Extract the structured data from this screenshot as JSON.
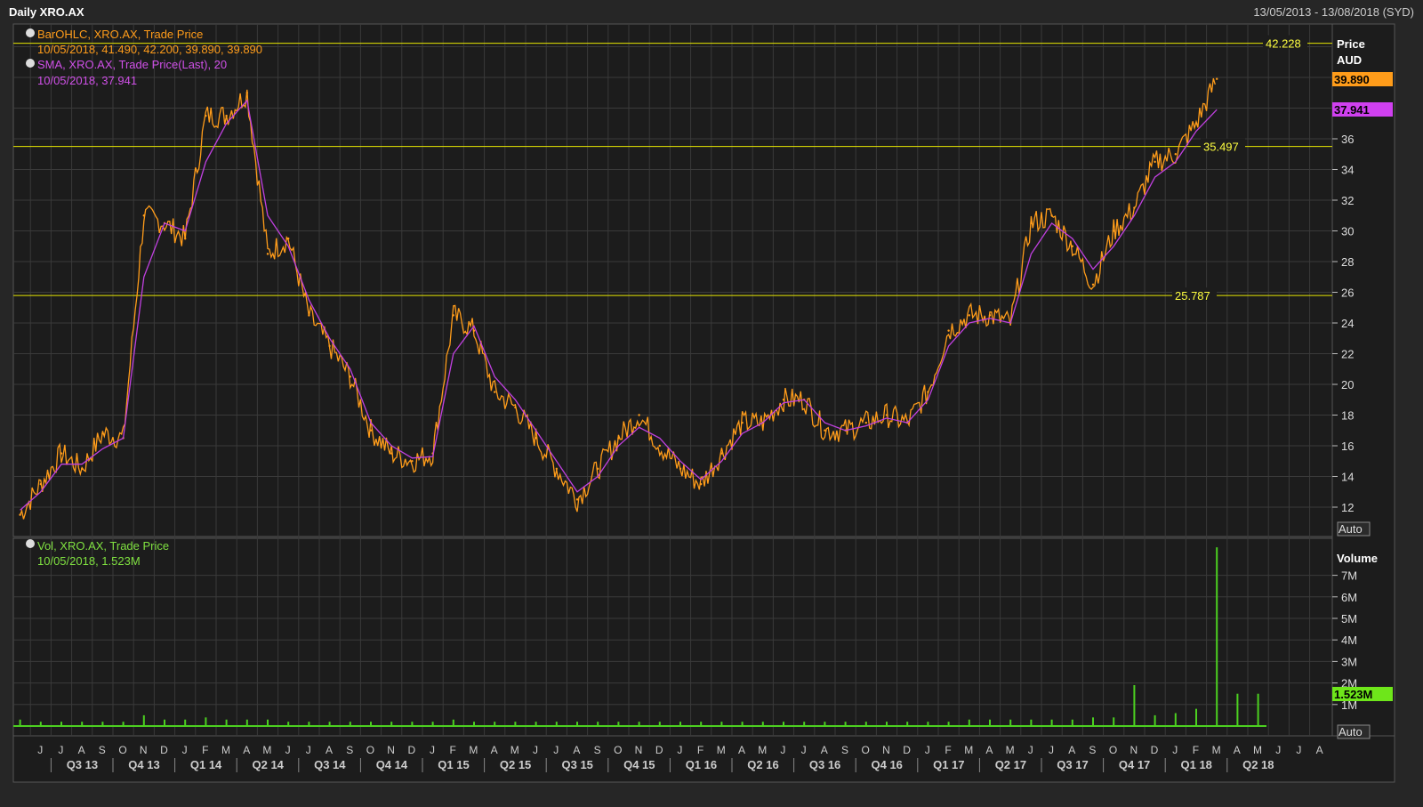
{
  "header": {
    "title": "Daily XRO.AX",
    "range": "13/05/2013 - 13/08/2018 (SYD)"
  },
  "legend": {
    "ohlc_title": "BarOHLC, XRO.AX, Trade Price",
    "ohlc_values": "10/05/2018, 41.490, 42.200, 39.890, 39.890",
    "sma_title": "SMA, XRO.AX, Trade Price(Last),  20",
    "sma_values": "10/05/2018, 37.941",
    "vol_title": "Vol, XRO.AX, Trade Price",
    "vol_values": "10/05/2018, 1.523M"
  },
  "price_axis": {
    "title": "Price",
    "unit": "AUD",
    "ticks": [
      "12",
      "14",
      "16",
      "18",
      "20",
      "22",
      "24",
      "26",
      "28",
      "30",
      "32",
      "34",
      "36"
    ],
    "current_price": "39.890",
    "current_sma": "37.941",
    "auto_label": "Auto"
  },
  "volume_axis": {
    "title": "Volume",
    "ticks": [
      "1M",
      "2M",
      "3M",
      "4M",
      "5M",
      "6M",
      "7M"
    ],
    "current_volume": "1.523M",
    "auto_label": "Auto"
  },
  "hlines": [
    {
      "label": "42.228",
      "value": 42.228
    },
    {
      "label": "35.497",
      "value": 35.497
    },
    {
      "label": "25.787",
      "value": 25.787
    }
  ],
  "x_axis": {
    "months": [
      "J",
      "J",
      "A",
      "S",
      "O",
      "N",
      "D",
      "J",
      "F",
      "M",
      "A",
      "M",
      "J",
      "J",
      "A",
      "S",
      "O",
      "N",
      "D",
      "J",
      "F",
      "M",
      "A",
      "M",
      "J",
      "J",
      "A",
      "S",
      "O",
      "N",
      "D",
      "J",
      "F",
      "M",
      "A",
      "M",
      "J",
      "J",
      "A",
      "S",
      "O",
      "N",
      "D",
      "J",
      "F",
      "M",
      "A",
      "M",
      "J",
      "J",
      "A",
      "S",
      "O",
      "N",
      "D",
      "J",
      "F",
      "M",
      "A",
      "M",
      "J",
      "J",
      "A"
    ],
    "quarters": [
      "Q3 13",
      "Q4 13",
      "Q1 14",
      "Q2 14",
      "Q3 14",
      "Q4 14",
      "Q1 15",
      "Q2 15",
      "Q3 15",
      "Q4 15",
      "Q1 16",
      "Q2 16",
      "Q3 16",
      "Q4 16",
      "Q1 17",
      "Q2 17",
      "Q3 17",
      "Q4 17",
      "Q1 18",
      "Q2 18"
    ]
  },
  "colors": {
    "price": "#ff9c1a",
    "sma": "#c040e0",
    "volume": "#4cd020",
    "hline": "#e6e600",
    "grid": "#3a3a3a"
  },
  "chart_data": {
    "type": "line",
    "x": [
      "2013-05",
      "2013-06",
      "2013-07",
      "2013-08",
      "2013-09",
      "2013-10",
      "2013-11",
      "2013-12",
      "2014-01",
      "2014-02",
      "2014-03",
      "2014-04",
      "2014-05",
      "2014-06",
      "2014-07",
      "2014-08",
      "2014-09",
      "2014-10",
      "2014-11",
      "2014-12",
      "2015-01",
      "2015-02",
      "2015-03",
      "2015-04",
      "2015-05",
      "2015-06",
      "2015-07",
      "2015-08",
      "2015-09",
      "2015-10",
      "2015-11",
      "2015-12",
      "2016-01",
      "2016-02",
      "2016-03",
      "2016-04",
      "2016-05",
      "2016-06",
      "2016-07",
      "2016-08",
      "2016-09",
      "2016-10",
      "2016-11",
      "2016-12",
      "2017-01",
      "2017-02",
      "2017-03",
      "2017-04",
      "2017-05",
      "2017-06",
      "2017-07",
      "2017-08",
      "2017-09",
      "2017-10",
      "2017-11",
      "2017-12",
      "2018-01",
      "2018-02",
      "2018-03",
      "2018-04",
      "2018-05"
    ],
    "series": [
      {
        "values": [
          11.5,
          13.5,
          15.5,
          14.5,
          16.8,
          16.5,
          31.0,
          30.5,
          29.5,
          37.5,
          37.5,
          39.0,
          28.5,
          29.5,
          24.5,
          22.5,
          20.5,
          17.0,
          15.5,
          15.0,
          15.5,
          24.5,
          23.5,
          19.5,
          18.5,
          16.5,
          14.5,
          12.5,
          14.5,
          16.5,
          18.0,
          16.0,
          14.5,
          13.5,
          15.5,
          17.5,
          17.5,
          19.0,
          19.0,
          17.0,
          17.0,
          17.5,
          18.0,
          17.5,
          19.5,
          23.5,
          24.5,
          24.5,
          24.0,
          30.5,
          31.0,
          29.0,
          26.5,
          30.0,
          31.5,
          34.5,
          35.0,
          37.0,
          39.9
        ]
      },
      {
        "name": "SMA, XRO.AX, Trade Price(Last),  20",
        "values": [
          11.8,
          13.0,
          14.8,
          14.8,
          15.8,
          16.5,
          27.0,
          30.5,
          30.0,
          34.5,
          37.0,
          38.5,
          31.0,
          29.0,
          25.5,
          23.0,
          21.0,
          17.5,
          16.0,
          15.2,
          15.3,
          22.0,
          23.8,
          20.5,
          19.0,
          17.0,
          15.0,
          13.0,
          14.0,
          16.0,
          17.2,
          16.5,
          15.0,
          13.8,
          15.0,
          16.8,
          17.5,
          18.8,
          19.0,
          17.5,
          17.0,
          17.3,
          17.8,
          17.5,
          19.0,
          22.5,
          24.0,
          24.3,
          24.0,
          28.5,
          30.5,
          29.5,
          27.5,
          29.0,
          31.0,
          33.5,
          34.5,
          36.5,
          37.9
        ]
      },
      {
        "name": "Vol, XRO.AX, Trade Price",
        "values": [
          0.3,
          0.2,
          0.2,
          0.2,
          0.2,
          0.2,
          0.5,
          0.3,
          0.3,
          0.4,
          0.3,
          0.3,
          0.3,
          0.2,
          0.2,
          0.2,
          0.2,
          0.2,
          0.2,
          0.2,
          0.2,
          0.3,
          0.2,
          0.2,
          0.2,
          0.2,
          0.2,
          0.2,
          0.2,
          0.2,
          0.2,
          0.2,
          0.2,
          0.2,
          0.2,
          0.2,
          0.2,
          0.2,
          0.2,
          0.2,
          0.2,
          0.2,
          0.2,
          0.2,
          0.2,
          0.2,
          0.3,
          0.3,
          0.3,
          0.3,
          0.3,
          0.3,
          0.4,
          0.4,
          1.9,
          0.5,
          0.6,
          0.8,
          8.3,
          1.5,
          1.5
        ]
      }
    ],
    "ylim": [
      11,
      44
    ]
  }
}
